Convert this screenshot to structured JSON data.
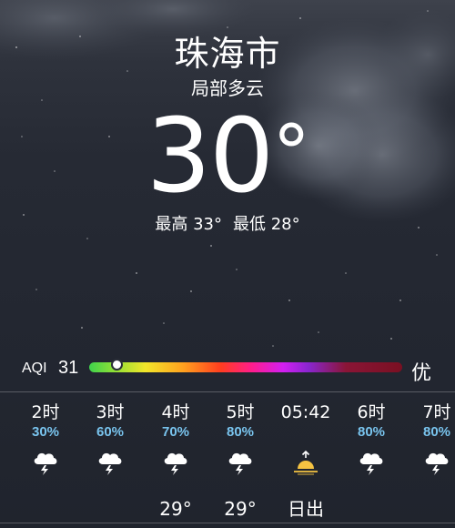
{
  "location": {
    "city": "珠海市",
    "condition": "局部多云"
  },
  "current": {
    "temperature": "30",
    "degree_symbol": "°",
    "high": "最高 33°",
    "low": "最低 28°"
  },
  "aqi": {
    "label": "AQI",
    "value": "31",
    "grade": "优",
    "level_fraction": 0.09
  },
  "hourly": [
    {
      "time": "2时",
      "pop": "30%",
      "icon": "thunderstorm-icon",
      "temp": ""
    },
    {
      "time": "3时",
      "pop": "60%",
      "icon": "thunderstorm-icon",
      "temp": ""
    },
    {
      "time": "4时",
      "pop": "70%",
      "icon": "thunderstorm-icon",
      "temp": "29°"
    },
    {
      "time": "5时",
      "pop": "80%",
      "icon": "thunderstorm-icon",
      "temp": "29°"
    },
    {
      "time": "05:42",
      "pop": "",
      "icon": "sunrise-icon",
      "temp": "日出"
    },
    {
      "time": "6时",
      "pop": "80%",
      "icon": "thunderstorm-icon",
      "temp": ""
    },
    {
      "time": "7时",
      "pop": "80%",
      "icon": "thunderstorm-icon",
      "temp": ""
    }
  ],
  "colors": {
    "background": "#262a34",
    "precipitation_text": "#79c4ee",
    "sunrise_icon": "#f5c342"
  }
}
